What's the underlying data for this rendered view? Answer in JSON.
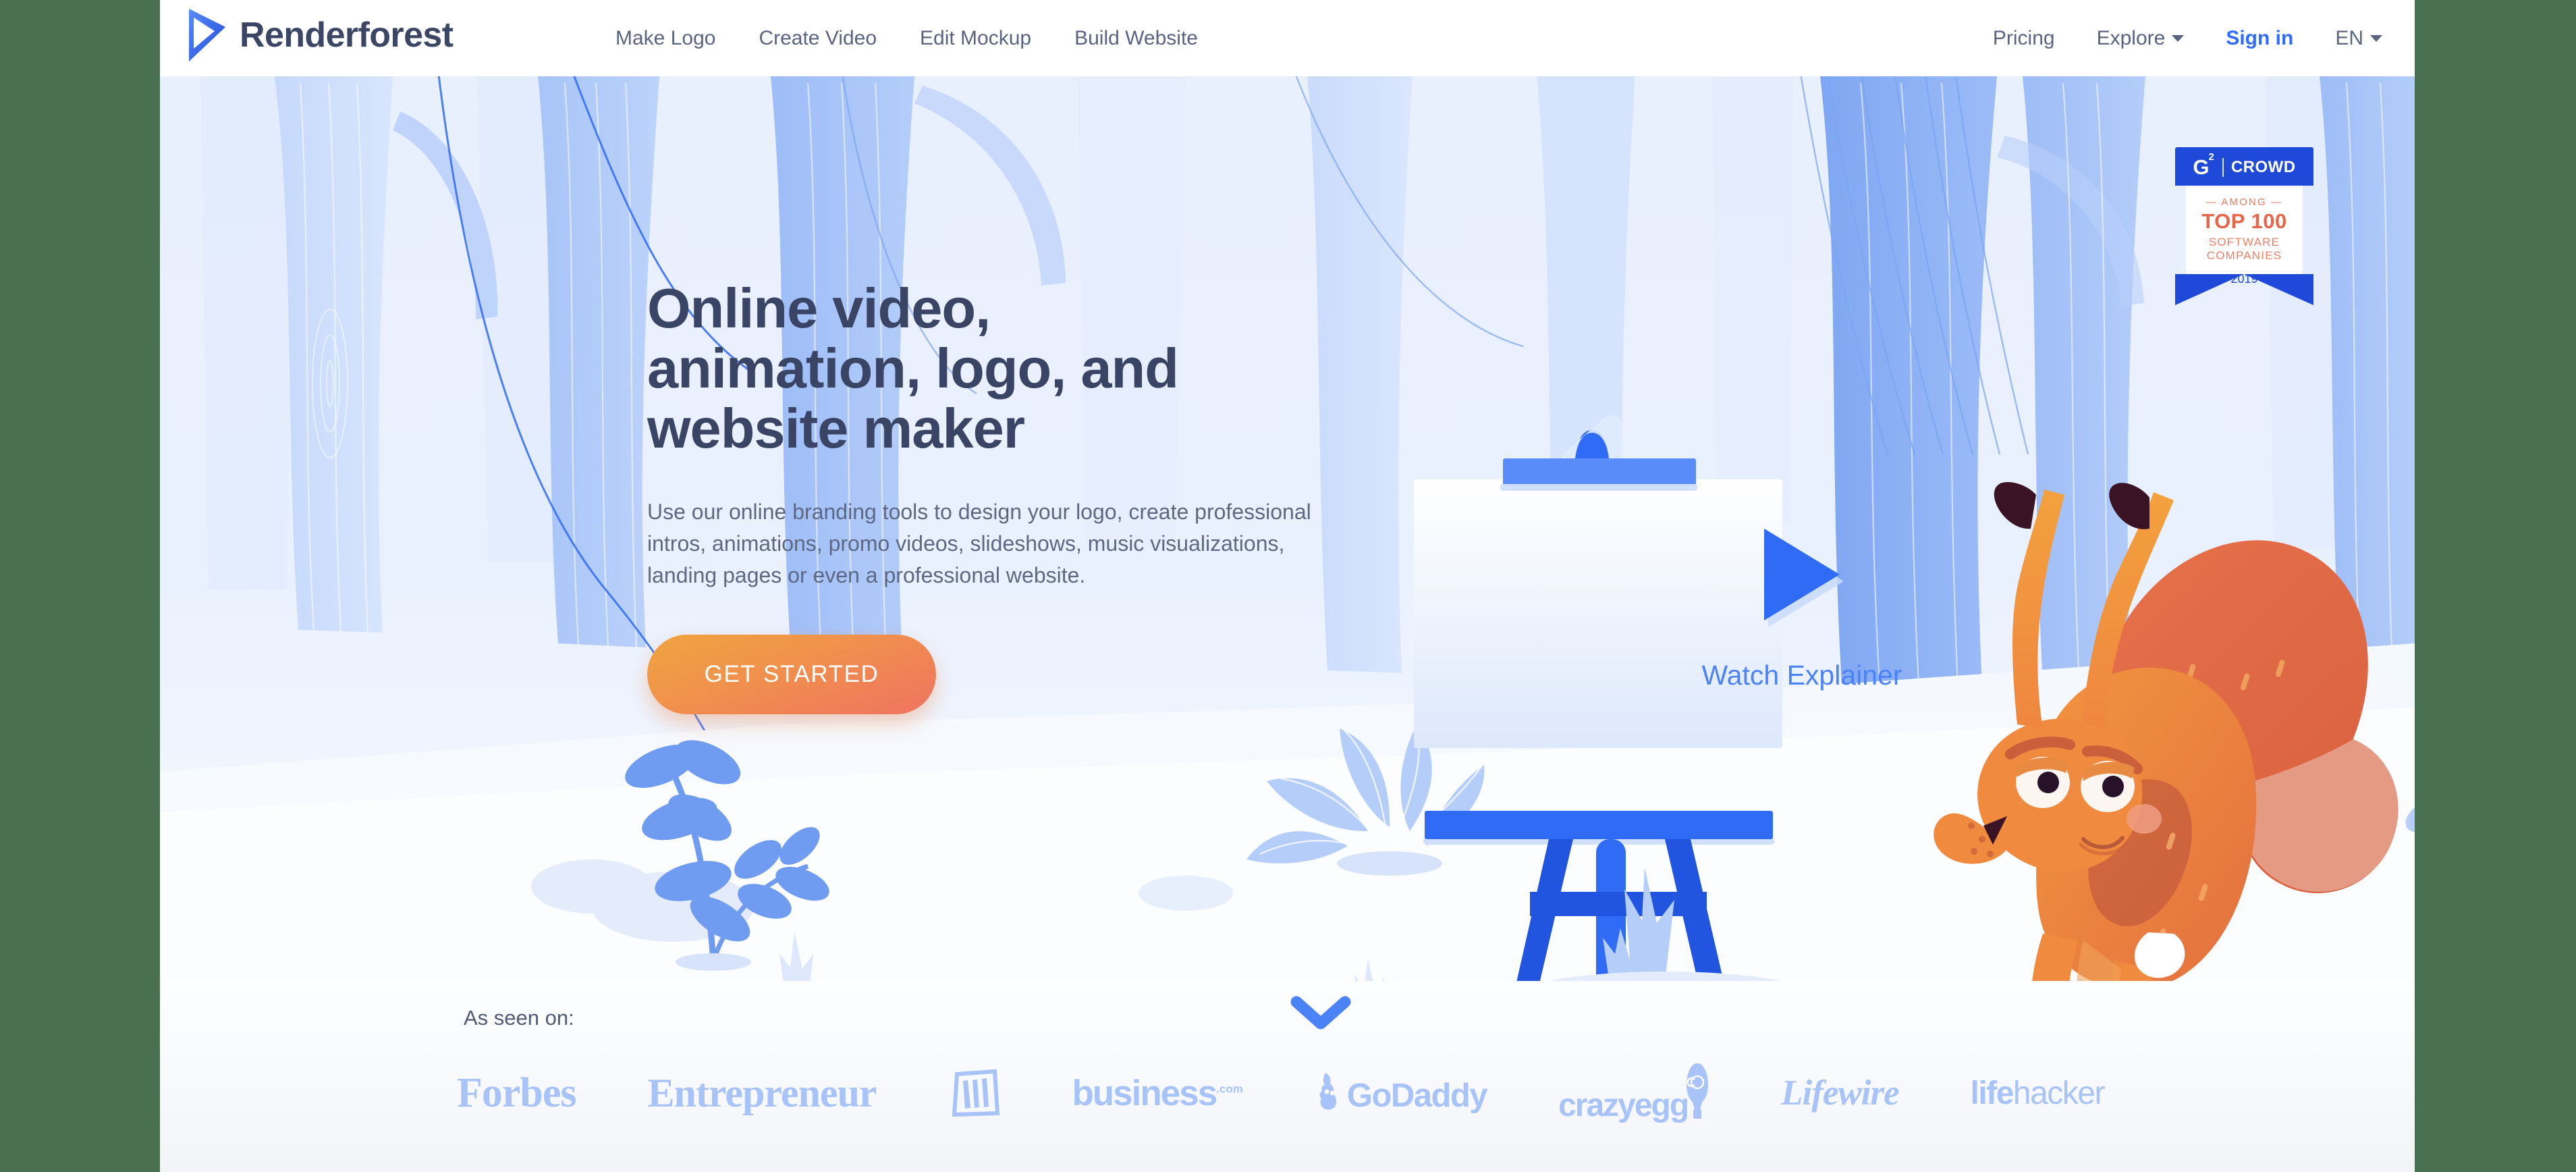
{
  "brand": {
    "name": "Renderforest",
    "logo_icon": "play-logo-icon",
    "accent_blue": "#2f6bff",
    "text_navy": "#3a4663"
  },
  "header": {
    "nav": [
      {
        "label": "Make Logo"
      },
      {
        "label": "Create Video"
      },
      {
        "label": "Edit Mockup"
      },
      {
        "label": "Build Website"
      }
    ],
    "right": {
      "pricing_label": "Pricing",
      "explore_label": "Explore",
      "signin_label": "Sign in",
      "language_label": "EN"
    }
  },
  "hero": {
    "title": "Online video,\nanimation, logo, and\nwebsite maker",
    "subtitle": "Use our online branding tools to design your logo, create professional\nintros, animations, promo videos, slideshows, music visualizations,\nlanding pages or even a professional website.",
    "cta_label": "GET STARTED",
    "watch_label": "Watch Explainer",
    "cta_gradient_from": "#f0a33f",
    "cta_gradient_to": "#ef7360"
  },
  "badge": {
    "brand_g": "G",
    "brand_sup": "2",
    "brand_crowd": "CROWD",
    "among": "— AMONG —",
    "rank": "TOP 100",
    "category_line1": "SOFTWARE",
    "category_line2": "COMPANIES",
    "year": "2019",
    "badge_blue": "#1f49d8",
    "badge_orange": "#e8654a"
  },
  "asseen": {
    "label": "As seen on:",
    "logos": [
      {
        "name": "Forbes",
        "text": "Forbes"
      },
      {
        "name": "Entrepreneur",
        "text": "Entrepreneur"
      },
      {
        "name": "The Wall Street Journal",
        "text": "WSJ"
      },
      {
        "name": "business.com",
        "text": "business",
        "suffix": ".com"
      },
      {
        "name": "GoDaddy",
        "text": "GoDaddy"
      },
      {
        "name": "crazyegg",
        "text": "crazyegg"
      },
      {
        "name": "Lifewire",
        "text": "Lifewire"
      },
      {
        "name": "lifehacker",
        "text_bold": "life",
        "text_light": "hacker"
      }
    ],
    "logo_color": "#a8c3f8"
  },
  "scroll": {
    "icon": "chevron-down-icon",
    "color": "#4b82f5"
  },
  "illustration": {
    "scene": "winter-forest-with-squirrel-and-easel",
    "palette": {
      "sky": "#eaf1fd",
      "tree_light": "#c9dbfb",
      "tree_mid": "#9dbdf7",
      "tree_dark": "#7aa4f2",
      "snow": "#f7faff",
      "easel_blue": "#2f6bf5",
      "squirrel_orange": "#ef8a3f",
      "squirrel_tail": "#df6a3e"
    }
  }
}
